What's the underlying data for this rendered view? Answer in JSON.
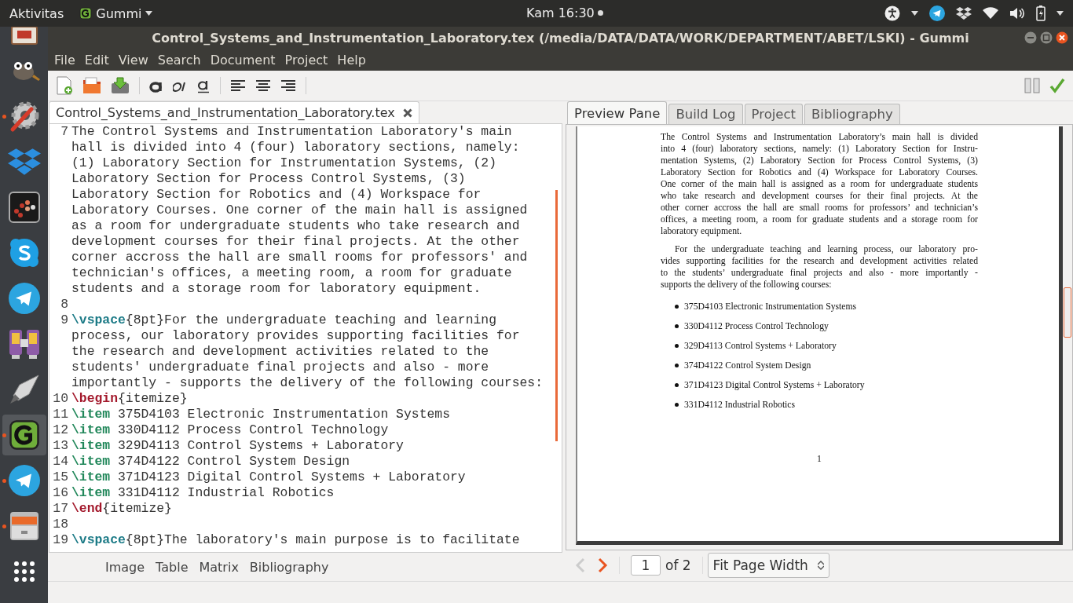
{
  "top_bar": {
    "activities": "Aktivitas",
    "app_menu": "Gummi",
    "clock": "Kam 16:30"
  },
  "dock": [
    {
      "kind": "presentation",
      "running": false,
      "selected": false
    },
    {
      "kind": "mascot",
      "running": false,
      "selected": false
    },
    {
      "kind": "tools",
      "running": true,
      "selected": false
    },
    {
      "kind": "dropbox",
      "running": false,
      "selected": false
    },
    {
      "kind": "dots",
      "running": false,
      "selected": false
    },
    {
      "kind": "skype",
      "running": false,
      "selected": false
    },
    {
      "kind": "telegram",
      "running": false,
      "selected": false
    },
    {
      "kind": "usb",
      "running": false,
      "selected": false
    },
    {
      "kind": "rocket",
      "running": false,
      "selected": false
    },
    {
      "kind": "gummi",
      "running": true,
      "selected": true
    },
    {
      "kind": "telegram",
      "running": true,
      "selected": false
    },
    {
      "kind": "files",
      "running": true,
      "selected": false
    },
    {
      "kind": "apps",
      "running": false,
      "selected": false
    }
  ],
  "window": {
    "title": "Control_Systems_and_Instrumentation_Laboratory.tex (/media/DATA/DATA/WORK/DEPARTMENT/ABET/LSKI) - Gummi"
  },
  "menu": [
    "File",
    "Edit",
    "View",
    "Search",
    "Document",
    "Project",
    "Help"
  ],
  "editor": {
    "tab": "Control_Systems_and_Instrumentation_Laboratory.tex",
    "rows": [
      {
        "number": "7",
        "parts": [
          {
            "kind": "plain",
            "text": "The Control Systems and Instrumentation Laboratory's main"
          }
        ]
      },
      {
        "parts": [
          {
            "kind": "plain",
            "text": "hall is divided into 4 (four) laboratory sections, namely:"
          }
        ]
      },
      {
        "parts": [
          {
            "kind": "plain",
            "text": "(1) Laboratory Section for Instrumentation Systems, (2)"
          }
        ]
      },
      {
        "parts": [
          {
            "kind": "plain",
            "text": "Laboratory Section for Process Control Systems, (3)"
          }
        ]
      },
      {
        "parts": [
          {
            "kind": "plain",
            "text": "Laboratory Section for Robotics and (4) Workspace for"
          }
        ]
      },
      {
        "parts": [
          {
            "kind": "plain",
            "text": "Laboratory Courses. One corner of the main hall is assigned"
          }
        ]
      },
      {
        "parts": [
          {
            "kind": "plain",
            "text": "as a room for undergraduate students who take research and"
          }
        ]
      },
      {
        "parts": [
          {
            "kind": "plain",
            "text": "development courses for their final projects. At the other"
          }
        ]
      },
      {
        "parts": [
          {
            "kind": "plain",
            "text": "corner accross the hall are small rooms for professors' and"
          }
        ]
      },
      {
        "parts": [
          {
            "kind": "plain",
            "text": "technician's offices, a meeting room, a room for graduate"
          }
        ]
      },
      {
        "parts": [
          {
            "kind": "plain",
            "text": "students and a storage room for laboratory equipment."
          }
        ]
      },
      {
        "number": "8",
        "parts": []
      },
      {
        "number": "9",
        "parts": [
          {
            "kind": "spacing",
            "text": "\\vspace"
          },
          {
            "kind": "plain",
            "text": "{8pt}For the undergraduate teaching and learning"
          }
        ]
      },
      {
        "parts": [
          {
            "kind": "plain",
            "text": "process, our laboratory provides supporting facilities for"
          }
        ]
      },
      {
        "parts": [
          {
            "kind": "plain",
            "text": "the research and development activities related to the"
          }
        ]
      },
      {
        "parts": [
          {
            "kind": "plain",
            "text": "students' undergraduate final projects and also - more"
          }
        ]
      },
      {
        "parts": [
          {
            "kind": "plain",
            "text": "importantly - supports the delivery of the following courses:"
          }
        ]
      },
      {
        "number": "10",
        "parts": [
          {
            "kind": "environment",
            "text": "\\begin"
          },
          {
            "kind": "plain",
            "text": "{itemize}"
          }
        ]
      },
      {
        "number": "11",
        "parts": [
          {
            "kind": "item",
            "text": "\\item"
          },
          {
            "kind": "plain",
            "text": " 375D4103 Electronic Instrumentation Systems"
          }
        ]
      },
      {
        "number": "12",
        "parts": [
          {
            "kind": "item",
            "text": "\\item"
          },
          {
            "kind": "plain",
            "text": " 330D4112 Process Control Technology"
          }
        ]
      },
      {
        "number": "13",
        "parts": [
          {
            "kind": "item",
            "text": "\\item"
          },
          {
            "kind": "plain",
            "text": " 329D4113 Control Systems + Laboratory"
          }
        ]
      },
      {
        "number": "14",
        "parts": [
          {
            "kind": "item",
            "text": "\\item"
          },
          {
            "kind": "plain",
            "text": " 374D4122 Control System Design"
          }
        ]
      },
      {
        "number": "15",
        "parts": [
          {
            "kind": "item",
            "text": "\\item"
          },
          {
            "kind": "plain",
            "text": " 371D4123 Digital Control Systems + Laboratory"
          }
        ]
      },
      {
        "number": "16",
        "parts": [
          {
            "kind": "item",
            "text": "\\item"
          },
          {
            "kind": "plain",
            "text": " 331D4112 Industrial Robotics"
          }
        ]
      },
      {
        "number": "17",
        "parts": [
          {
            "kind": "environment",
            "text": "\\end"
          },
          {
            "kind": "plain",
            "text": "{itemize}"
          }
        ]
      },
      {
        "number": "18",
        "parts": []
      },
      {
        "number": "19",
        "parts": [
          {
            "kind": "spacing",
            "text": "\\vspace"
          },
          {
            "kind": "plain",
            "text": "{8pt}The laboratory's main purpose is to facilitate"
          }
        ]
      }
    ],
    "insert_buttons": [
      "Image",
      "Table",
      "Matrix",
      "Bibliography"
    ]
  },
  "preview": {
    "tabs": [
      {
        "label": "Preview Pane",
        "selected": true
      },
      {
        "label": "Build Log",
        "selected": false
      },
      {
        "label": "Project",
        "selected": false
      },
      {
        "label": "Bibliography",
        "selected": false
      }
    ],
    "paragraphs": [
      {
        "indent": false,
        "lines": [
          "The Control Systems and Instrumentation Laboratory’s main hall is divided",
          "into 4 (four) laboratory sections, namely: (1) Laboratory Section for Instru-",
          "mentation Systems, (2) Laboratory Section for Process Control Systems, (3)",
          "Laboratory Section for Robotics and (4) Workspace for Laboratory Courses.",
          "One corner of the main hall is assigned as a room for undergraduate students",
          "who take research and development courses for their final projects.  At the",
          "other corner accross the hall are small rooms for professors’ and technician’s",
          "offices, a meeting room, a room for graduate students and a storage room for",
          "laboratory equipment."
        ]
      },
      {
        "indent": true,
        "lines": [
          "For the undergraduate teaching and learning process, our laboratory pro-",
          "vides supporting facilities for the research and development activities related",
          "to the students’ undergraduate final projects and also - more importantly -",
          "supports the delivery of the following courses:"
        ]
      }
    ],
    "items": [
      "375D4103 Electronic Instrumentation Systems",
      "330D4112 Process Control Technology",
      "329D4113 Control Systems + Laboratory",
      "374D4122 Control System Design",
      "371D4123 Digital Control Systems + Laboratory",
      "331D4112 Industrial Robotics"
    ],
    "page_number": "1",
    "nav": {
      "page": "1",
      "of": "of 2",
      "zoom": "Fit Page Width",
      "prev_disabled": true
    }
  }
}
